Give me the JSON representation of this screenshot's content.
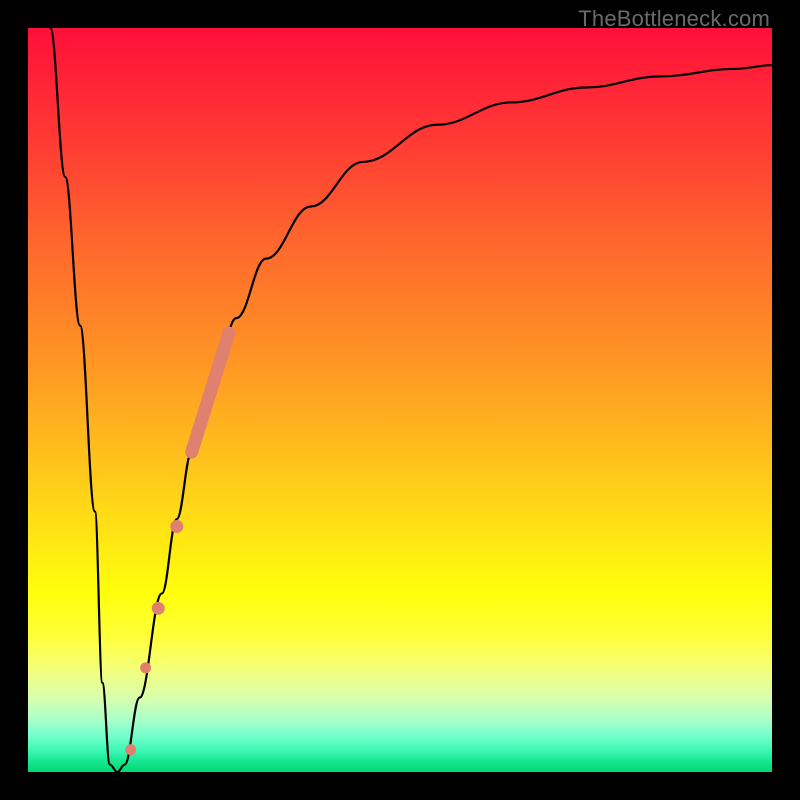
{
  "watermark": "TheBottleneck.com",
  "chart_data": {
    "type": "line",
    "title": "",
    "xlabel": "",
    "ylabel": "",
    "xlim": [
      0,
      100
    ],
    "ylim": [
      0,
      100
    ],
    "grid": false,
    "legend": false,
    "gradient_stops": [
      {
        "pct": 0,
        "color": "#ff103a"
      },
      {
        "pct": 15,
        "color": "#ff3a34"
      },
      {
        "pct": 30,
        "color": "#ff6a2c"
      },
      {
        "pct": 45,
        "color": "#ff9624"
      },
      {
        "pct": 60,
        "color": "#ffc21c"
      },
      {
        "pct": 75,
        "color": "#ffff0c"
      },
      {
        "pct": 90,
        "color": "#d8ffad"
      },
      {
        "pct": 100,
        "color": "#00d873"
      }
    ],
    "series": [
      {
        "name": "bottleneck-curve",
        "x": [
          3,
          5,
          7,
          9,
          10,
          11,
          12,
          13,
          15,
          18,
          20,
          22,
          25,
          28,
          32,
          38,
          45,
          55,
          65,
          75,
          85,
          95,
          100
        ],
        "y": [
          100,
          80,
          60,
          35,
          12,
          1,
          0,
          1,
          10,
          24,
          34,
          43,
          53,
          61,
          69,
          76,
          82,
          87,
          90,
          92,
          93.5,
          94.5,
          95
        ]
      }
    ],
    "highlight_points": {
      "description": "salmon segment + dots near curve minimum right branch",
      "color": "#e0816f",
      "segment": {
        "x": [
          22,
          27
        ],
        "y": [
          43,
          59
        ]
      },
      "dots": [
        {
          "x": 17.5,
          "y": 22
        },
        {
          "x": 20.0,
          "y": 33
        },
        {
          "x": 15.8,
          "y": 14
        },
        {
          "x": 13.8,
          "y": 3
        }
      ]
    }
  }
}
